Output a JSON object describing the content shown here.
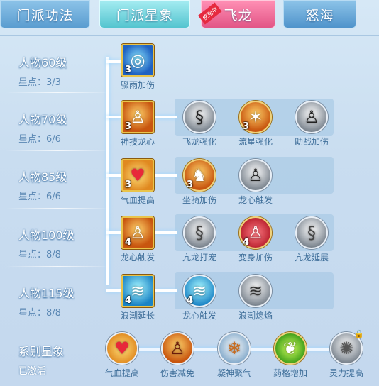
{
  "tabs": [
    {
      "label": "门派功法"
    },
    {
      "label": "门派星象"
    },
    {
      "label": "飞龙",
      "badge": "使用中"
    },
    {
      "label": "怒海"
    }
  ],
  "rows": [
    {
      "level": "人物60级",
      "points": "星点：3/3"
    },
    {
      "level": "人物70级",
      "points": "星点：6/6"
    },
    {
      "level": "人物85级",
      "points": "星点：6/6"
    },
    {
      "level": "人物100级",
      "points": "星点：8/8"
    },
    {
      "level": "人物115级",
      "points": "星点：8/8"
    }
  ],
  "skills": {
    "r1": [
      {
        "label": "骤雨加伤",
        "count": "3",
        "icon": "vortex-icon"
      }
    ],
    "r2": [
      {
        "label": "神技龙心",
        "count": "3",
        "icon": "flame-figure-icon"
      },
      {
        "label": "飞龙强化",
        "count": "",
        "icon": "dragon-icon"
      },
      {
        "label": "流星强化",
        "count": "3",
        "icon": "meteor-icon"
      },
      {
        "label": "助战加伤",
        "count": "",
        "icon": "figure-icon"
      }
    ],
    "r3": [
      {
        "label": "气血提高",
        "count": "3",
        "icon": "heart-icon"
      },
      {
        "label": "坐骑加伤",
        "count": "3",
        "icon": "beast-icon"
      },
      {
        "label": "龙心触发",
        "count": "",
        "icon": "figure-icon"
      }
    ],
    "r4": [
      {
        "label": "龙心触发",
        "count": "4",
        "icon": "flame-figure-icon"
      },
      {
        "label": "亢龙打宠",
        "count": "",
        "icon": "dragon-icon"
      },
      {
        "label": "变身加伤",
        "count": "4",
        "icon": "red-figure-icon"
      },
      {
        "label": "亢龙延展",
        "count": "",
        "icon": "dragon-icon"
      }
    ],
    "r5": [
      {
        "label": "浪潮延长",
        "count": "4",
        "icon": "wave-icon"
      },
      {
        "label": "龙心触发",
        "count": "4",
        "icon": "wave-icon"
      },
      {
        "label": "浪潮熄焰",
        "count": "",
        "icon": "wave-icon"
      }
    ]
  },
  "system": {
    "title": "系别星象",
    "status": "已激活",
    "items": [
      {
        "label": "气血提高",
        "icon": "heart-icon"
      },
      {
        "label": "伤害减免",
        "icon": "figure-icon"
      },
      {
        "label": "凝神聚气",
        "icon": "spirit-icon"
      },
      {
        "label": "药格增加",
        "icon": "herb-icon"
      },
      {
        "label": "灵力提高",
        "icon": "spirit-icon"
      }
    ]
  }
}
